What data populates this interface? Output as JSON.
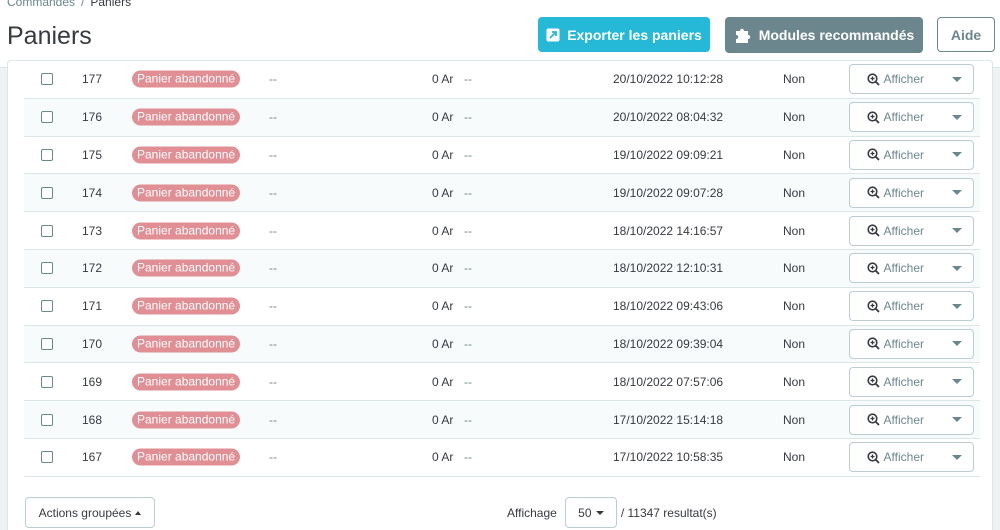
{
  "breadcrumb": {
    "parent": "Commandes",
    "separator": "/",
    "current": "Paniers"
  },
  "page_title": "Paniers",
  "toolbar": {
    "export_label": "Exporter les paniers",
    "modules_label": "Modules recommandés",
    "help_label": "Aide"
  },
  "colors": {
    "primary": "#25b9d7",
    "secondary": "#6c868e",
    "badge_abandoned": "#e08f95"
  },
  "rows": [
    {
      "id": "177",
      "status": "Panier abandonné",
      "customer": "--",
      "total": "0 Ar",
      "carrier": "--",
      "date": "20/10/2022 10:12:28",
      "online": "Non",
      "action": "Afficher"
    },
    {
      "id": "176",
      "status": "Panier abandonné",
      "customer": "--",
      "total": "0 Ar",
      "carrier": "--",
      "date": "20/10/2022 08:04:32",
      "online": "Non",
      "action": "Afficher"
    },
    {
      "id": "175",
      "status": "Panier abandonné",
      "customer": "--",
      "total": "0 Ar",
      "carrier": "--",
      "date": "19/10/2022 09:09:21",
      "online": "Non",
      "action": "Afficher"
    },
    {
      "id": "174",
      "status": "Panier abandonné",
      "customer": "--",
      "total": "0 Ar",
      "carrier": "--",
      "date": "19/10/2022 09:07:28",
      "online": "Non",
      "action": "Afficher"
    },
    {
      "id": "173",
      "status": "Panier abandonné",
      "customer": "--",
      "total": "0 Ar",
      "carrier": "--",
      "date": "18/10/2022 14:16:57",
      "online": "Non",
      "action": "Afficher"
    },
    {
      "id": "172",
      "status": "Panier abandonné",
      "customer": "--",
      "total": "0 Ar",
      "carrier": "--",
      "date": "18/10/2022 12:10:31",
      "online": "Non",
      "action": "Afficher"
    },
    {
      "id": "171",
      "status": "Panier abandonné",
      "customer": "--",
      "total": "0 Ar",
      "carrier": "--",
      "date": "18/10/2022 09:43:06",
      "online": "Non",
      "action": "Afficher"
    },
    {
      "id": "170",
      "status": "Panier abandonné",
      "customer": "--",
      "total": "0 Ar",
      "carrier": "--",
      "date": "18/10/2022 09:39:04",
      "online": "Non",
      "action": "Afficher"
    },
    {
      "id": "169",
      "status": "Panier abandonné",
      "customer": "--",
      "total": "0 Ar",
      "carrier": "--",
      "date": "18/10/2022 07:57:06",
      "online": "Non",
      "action": "Afficher"
    },
    {
      "id": "168",
      "status": "Panier abandonné",
      "customer": "--",
      "total": "0 Ar",
      "carrier": "--",
      "date": "17/10/2022 15:14:18",
      "online": "Non",
      "action": "Afficher"
    },
    {
      "id": "167",
      "status": "Panier abandonné",
      "customer": "--",
      "total": "0 Ar",
      "carrier": "--",
      "date": "17/10/2022 10:58:35",
      "online": "Non",
      "action": "Afficher"
    }
  ],
  "footer": {
    "bulk_actions_label": "Actions groupées",
    "display_label": "Affichage",
    "per_page": "50",
    "results_text": "/ 11347 resultat(s)"
  }
}
